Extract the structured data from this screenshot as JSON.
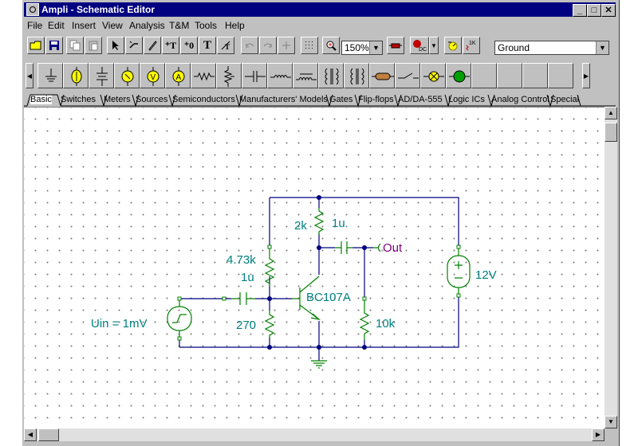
{
  "window": {
    "title": "Ampli - Schematic Editor"
  },
  "menu": [
    "File",
    "Edit",
    "Insert",
    "View",
    "Analysis",
    "T&M",
    "Tools",
    "Help"
  ],
  "toolbar": {
    "zoom": "150%",
    "component_select": "Ground"
  },
  "tabs": [
    "Basic",
    "Switches",
    "Meters",
    "Sources",
    "Semiconductors",
    "Manufacturers' Models",
    "Gates",
    "Flip-flops",
    "AD/DA-555",
    "Logic ICs",
    "Analog Control",
    "Special"
  ],
  "schematic": {
    "source_label": "Uin = 1mV",
    "c_in": "1u",
    "r_top": "4.73k",
    "r_bottom": "270",
    "r_collector": "2k",
    "c_out": "1u",
    "out_label": "Out",
    "transistor": "BC107A",
    "r_load": "10k",
    "supply": "12V"
  },
  "colors": {
    "wire": "#000080",
    "component": "#008000",
    "label": "#008080",
    "out": "#800080",
    "titlebar": "#000080"
  }
}
